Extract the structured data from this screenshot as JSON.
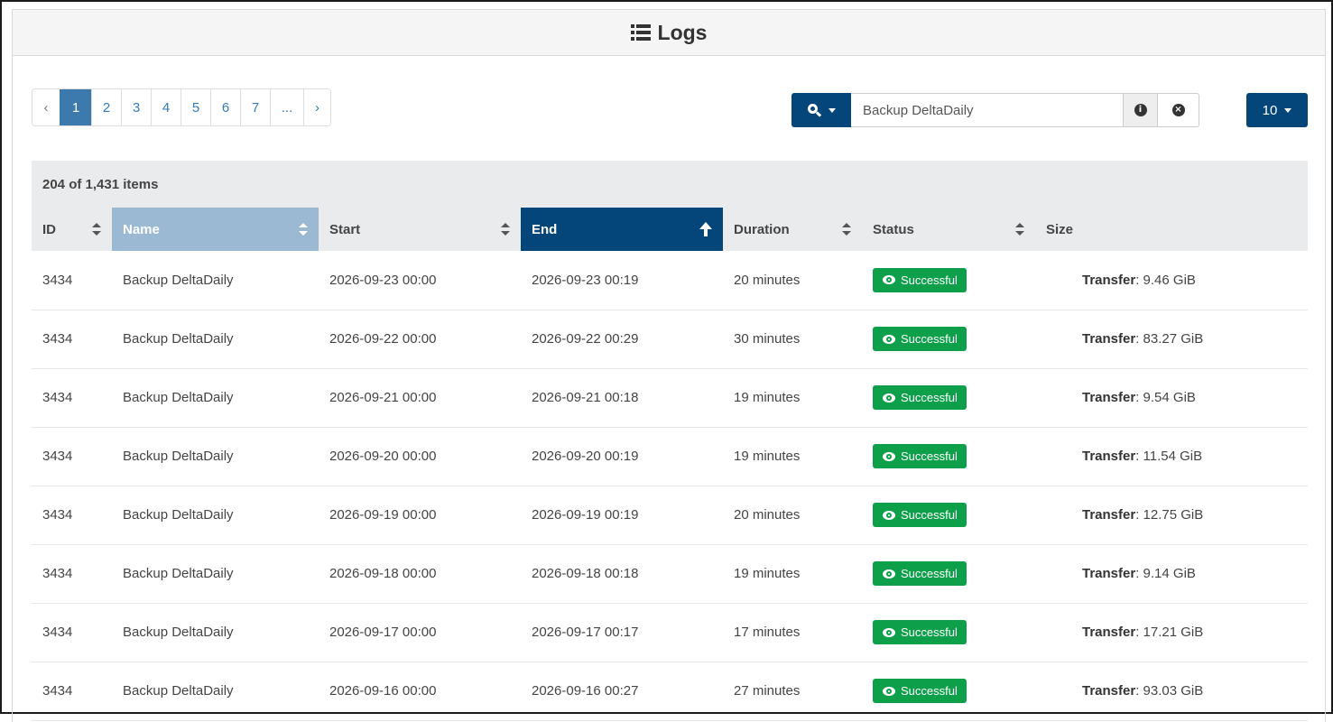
{
  "panel": {
    "title": "Logs"
  },
  "pagination": {
    "prev": "‹",
    "pages": [
      "1",
      "2",
      "3",
      "4",
      "5",
      "6",
      "7",
      "..."
    ],
    "active": "1",
    "next": "›"
  },
  "search": {
    "value": "Backup DeltaDaily"
  },
  "per_page": {
    "label": "10"
  },
  "table": {
    "summary": "204 of 1,431 items",
    "columns": [
      "ID",
      "Name",
      "Start",
      "End",
      "Duration",
      "Status",
      "Size"
    ],
    "sorted_by": "End",
    "rows": [
      {
        "id": "3434",
        "name": "Backup DeltaDaily",
        "start": "2026-09-23 00:00",
        "end": "2026-09-23 00:19",
        "duration": "20 minutes",
        "status": "Successful",
        "size_label": "Transfer",
        "size_value": ": 9.46 GiB"
      },
      {
        "id": "3434",
        "name": "Backup DeltaDaily",
        "start": "2026-09-22 00:00",
        "end": "2026-09-22 00:29",
        "duration": "30 minutes",
        "status": "Successful",
        "size_label": "Transfer",
        "size_value": ": 83.27 GiB"
      },
      {
        "id": "3434",
        "name": "Backup DeltaDaily",
        "start": "2026-09-21 00:00",
        "end": "2026-09-21 00:18",
        "duration": "19 minutes",
        "status": "Successful",
        "size_label": "Transfer",
        "size_value": ": 9.54 GiB"
      },
      {
        "id": "3434",
        "name": "Backup DeltaDaily",
        "start": "2026-09-20 00:00",
        "end": "2026-09-20 00:19",
        "duration": "19 minutes",
        "status": "Successful",
        "size_label": "Transfer",
        "size_value": ": 11.54 GiB"
      },
      {
        "id": "3434",
        "name": "Backup DeltaDaily",
        "start": "2026-09-19 00:00",
        "end": "2026-09-19 00:19",
        "duration": "20 minutes",
        "status": "Successful",
        "size_label": "Transfer",
        "size_value": ": 12.75 GiB"
      },
      {
        "id": "3434",
        "name": "Backup DeltaDaily",
        "start": "2026-09-18 00:00",
        "end": "2026-09-18 00:18",
        "duration": "19 minutes",
        "status": "Successful",
        "size_label": "Transfer",
        "size_value": ": 9.14 GiB"
      },
      {
        "id": "3434",
        "name": "Backup DeltaDaily",
        "start": "2026-09-17 00:00",
        "end": "2026-09-17 00:17",
        "duration": "17 minutes",
        "status": "Successful",
        "size_label": "Transfer",
        "size_value": ": 17.21 GiB"
      },
      {
        "id": "3434",
        "name": "Backup DeltaDaily",
        "start": "2026-09-16 00:00",
        "end": "2026-09-16 00:27",
        "duration": "27 minutes",
        "status": "Successful",
        "size_label": "Transfer",
        "size_value": ": 93.03 GiB"
      }
    ]
  },
  "icons": {
    "title": "list-icon",
    "search": "search-icon",
    "info": "info-icon",
    "clear": "clear-icon",
    "sort": "sort-icon",
    "sort_asc": "arrow-up-icon",
    "status": "eye-icon"
  },
  "colors": {
    "primary": "#04457a",
    "pagination_active": "#3c7aae",
    "name_sorted_header": "#9cb9d3",
    "success": "#0e9f4a"
  }
}
